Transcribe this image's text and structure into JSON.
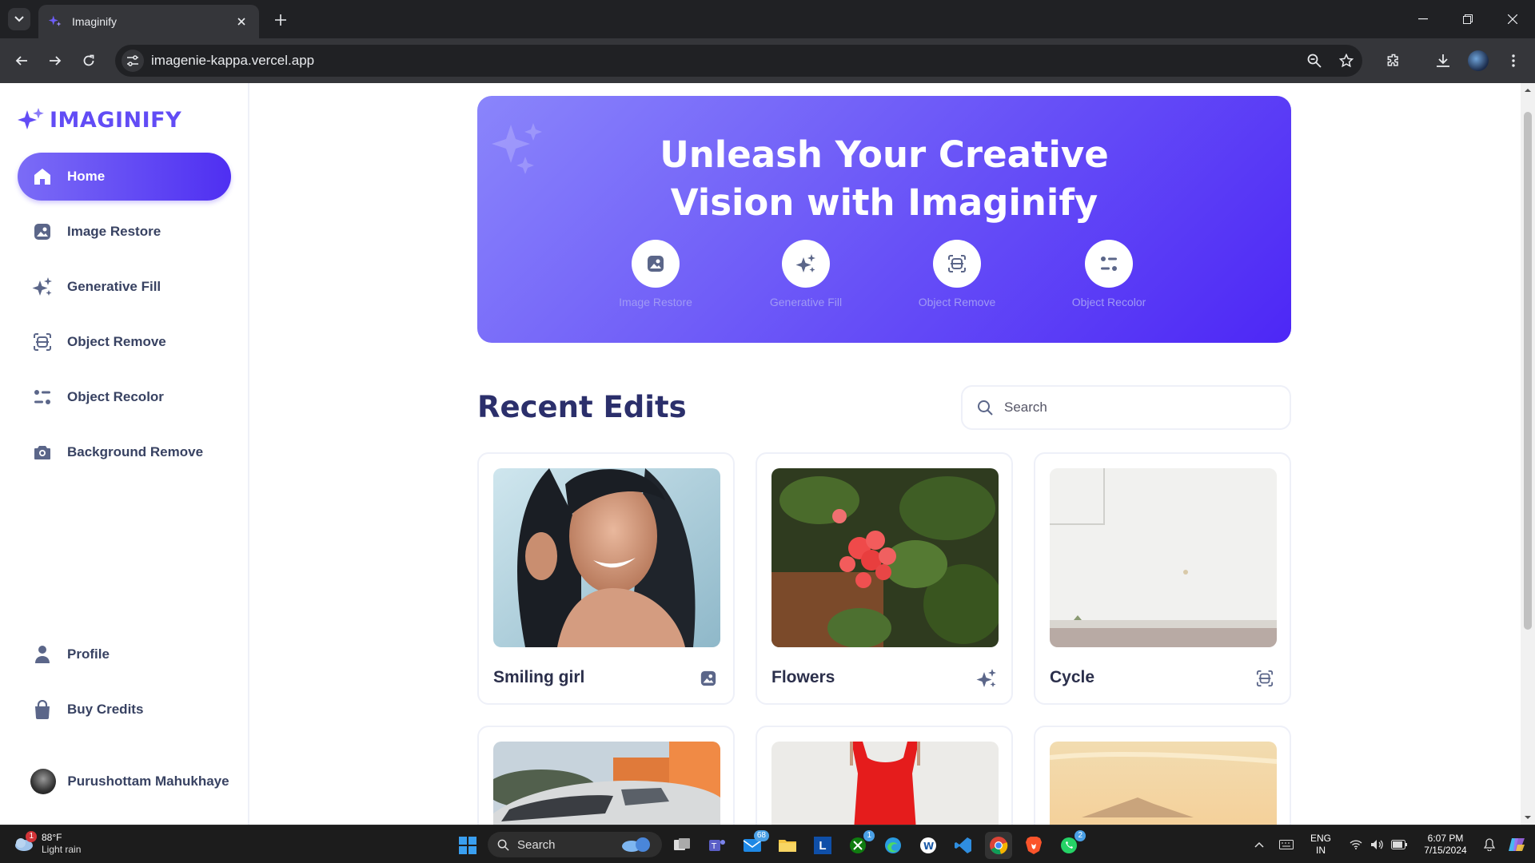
{
  "browser": {
    "tab_title": "Imaginify",
    "url": "imagenie-kappa.vercel.app"
  },
  "sidebar": {
    "logo_text": "IMAGINIFY",
    "items": [
      {
        "label": "Home",
        "icon": "home-icon",
        "active": true
      },
      {
        "label": "Image Restore",
        "icon": "image-icon"
      },
      {
        "label": "Generative Fill",
        "icon": "stars-icon"
      },
      {
        "label": "Object Remove",
        "icon": "scan-icon"
      },
      {
        "label": "Object Recolor",
        "icon": "filter-icon"
      },
      {
        "label": "Background Remove",
        "icon": "camera-icon"
      }
    ],
    "bottom_items": [
      {
        "label": "Profile",
        "icon": "user-icon"
      },
      {
        "label": "Buy Credits",
        "icon": "bag-icon"
      }
    ],
    "user_name": "Purushottam Mahukhaye"
  },
  "hero": {
    "title_line1": "Unleash Your Creative",
    "title_line2": "Vision with Imaginify",
    "features": [
      {
        "label": "Image Restore",
        "icon": "image-icon"
      },
      {
        "label": "Generative Fill",
        "icon": "stars-icon"
      },
      {
        "label": "Object Remove",
        "icon": "scan-icon"
      },
      {
        "label": "Object Recolor",
        "icon": "filter-icon"
      }
    ]
  },
  "recent": {
    "title": "Recent Edits",
    "search_placeholder": "Search",
    "cards": [
      {
        "title": "Smiling girl",
        "icon": "image-icon"
      },
      {
        "title": "Flowers",
        "icon": "stars-icon"
      },
      {
        "title": "Cycle",
        "icon": "scan-icon"
      },
      {
        "title": "",
        "icon": "car"
      },
      {
        "title": "",
        "icon": "dress"
      },
      {
        "title": "",
        "icon": "mountain"
      }
    ]
  },
  "taskbar": {
    "weather_temp": "88°F",
    "weather_desc": "Light rain",
    "weather_badge": "1",
    "search_label": "Search",
    "mail_badge": "68",
    "xbox_badge": "1",
    "whatsapp_badge": "2",
    "lang_line1": "ENG",
    "lang_line2": "IN",
    "time": "6:07 PM",
    "date": "7/15/2024"
  },
  "colors": {
    "accent": "#624cf5",
    "hero_start": "#8a85fb",
    "hero_end": "#4d27f6",
    "text_dark": "#384262"
  }
}
